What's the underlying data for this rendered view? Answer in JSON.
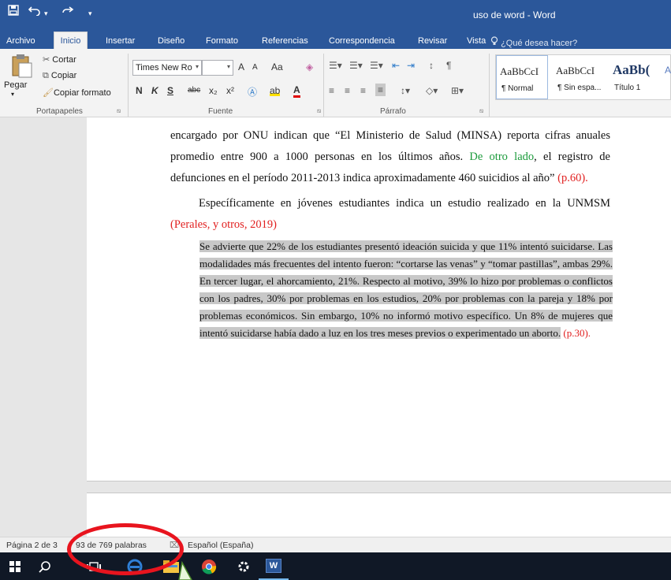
{
  "window": {
    "title": "uso de word - Word",
    "qat": {
      "save_icon": "floppy-disk-icon",
      "undo_icon": "undo-icon",
      "undo_caret": "▾",
      "redo_icon": "redo-icon",
      "customize": "▾"
    }
  },
  "menu": {
    "tabs": [
      "Archivo",
      "Inicio",
      "Insertar",
      "Diseño",
      "Formato",
      "Referencias",
      "Correspondencia",
      "Revisar",
      "Vista"
    ],
    "active": "Inicio",
    "tell_me": "¿Qué desea hacer?"
  },
  "ribbon": {
    "clipboard": {
      "paste": "Pegar",
      "cut": "Cortar",
      "copy": "Copiar",
      "format_painter": "Copiar formato",
      "label": "Portapapeles"
    },
    "font": {
      "name": "Times New Ro",
      "size": "",
      "grow": "A",
      "shrink": "A",
      "case": "Aa",
      "bold": "N",
      "italic": "K",
      "underline": "S",
      "strike": "abc",
      "subscript": "x₂",
      "superscript": "x²",
      "label": "Fuente"
    },
    "paragraph": {
      "label": "Párrafo",
      "pilcrow": "¶"
    },
    "styles": {
      "items": [
        {
          "preview": "AaBbCcI",
          "name": "¶ Normal"
        },
        {
          "preview": "AaBbCcI",
          "name": "¶ Sin espa..."
        },
        {
          "preview": "AaBb(",
          "name": "Título 1"
        }
      ],
      "overflow": "A"
    }
  },
  "document": {
    "para1": {
      "t1": "encargado por ONU indican que “El Ministerio de Salud (MINSA) reporta cifras anuales promedio entre 900 a 1000 personas en los últimos años. ",
      "t2": "De otro lado",
      "t3": ", el registro de defunciones en el período 2011-2013 indica aproximadamente 460 suicidios al año”",
      "t4": " (p.60)."
    },
    "para2": {
      "t1": "Específicamente en jóvenes estudiantes indica un estudio realizado en la UNMSM",
      "t2": "(Perales, y otros, 2019)"
    },
    "quote": {
      "body": "Se advierte que 22% de los estudiantes presentó ideación suicida y que 11% intentó suicidarse. Las modalidades más frecuentes del intento fueron: “cortarse las venas” y “tomar pastillas”, ambas 29%. En tercer lugar, el ahorcamiento, 21%. Respecto al motivo, 39% lo hizo por problemas o conflictos con los padres, 30% por problemas en los estudios, 20% por problemas con la pareja y 18% por problemas económicos. Sin embargo, 10% no informó motivo específico. Un 8% de mujeres que intentó suicidarse había dado a luz en los tres meses previos o experimentado un aborto.",
      "cite": " (p.30)."
    }
  },
  "status": {
    "page": "Página 2 de 3",
    "words": "93 de 769 palabras",
    "language": "Español (España)"
  },
  "taskbar": {
    "icons": [
      "windows-start-icon",
      "search-icon",
      "task-view-icon",
      "edge-icon",
      "file-explorer-icon",
      "chrome-icon",
      "settings-icon",
      "word-icon"
    ],
    "word_label": "W"
  },
  "colors": {
    "accent": "#2b579a",
    "highlight": "#c8c8c8",
    "green_text": "#1a9a3a",
    "red_text": "#e12020",
    "annotation": "#e8141e"
  }
}
